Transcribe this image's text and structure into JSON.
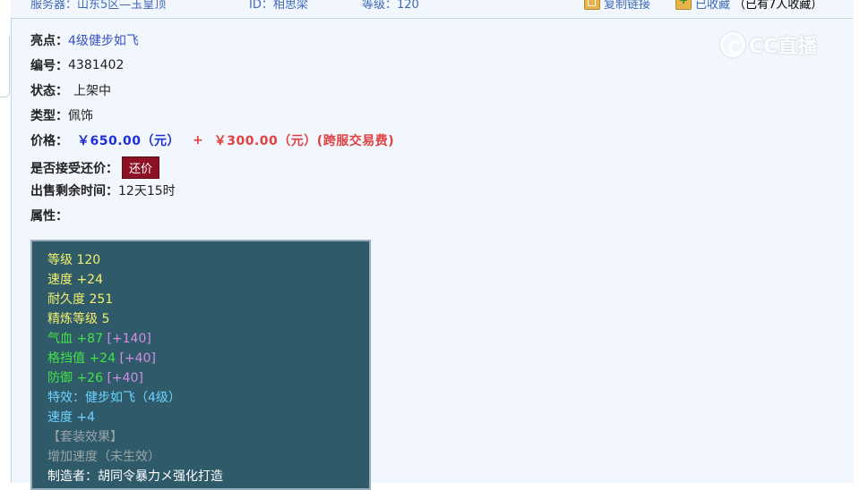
{
  "topbar": {
    "server_label": "服务器：",
    "server_value": "山东5区—玉皇顶",
    "id_label": "ID：",
    "id_value": "相思梁",
    "level_label": "等级：",
    "level_value": "120",
    "copy_link": "复制链接",
    "favorited": "已收藏",
    "fav_count": "（已有7人收藏）"
  },
  "info": {
    "highlight_label": "亮点：",
    "highlight_value": "4级健步如飞",
    "number_label": "编号：",
    "number_value": "4381402",
    "status_label": "状态：",
    "status_value": "上架中",
    "type_label": "类型：",
    "type_value": "佩饰",
    "price_label": "价格：",
    "price_value": "￥650.00（元）",
    "price_plus": "+",
    "price_fee": "￥300.00（元）(跨服交易费)",
    "bargain_label": "是否接受还价：",
    "bargain_button": "还价",
    "remaining_label": "出售剩余时间：",
    "remaining_value": "12天15时",
    "attr_label": "属性："
  },
  "attributes": {
    "level": "等级 120",
    "speed": "速度 +24",
    "durability": "耐久度 251",
    "refine": "精炼等级 5",
    "hp": "气血 +87",
    "hp_bonus": "[+140]",
    "block": "格挡值 +24",
    "block_bonus": "[+40]",
    "defense": "防御 +26",
    "defense_bonus": "[+40]",
    "effect": "特效：健步如飞（4级）",
    "speed_extra": "速度 +4",
    "set_title": "【套装效果】",
    "set_effect": "增加速度（未生效）",
    "maker": "制造者：胡同令暴力メ强化打造"
  },
  "watermark": {
    "text": "CC直播"
  },
  "colors": {
    "panel_bg": "#f2f6fd",
    "attr_bg": "#2f5a6a",
    "bargain_btn": "#8c1124",
    "price_blue": "#1d2fd8",
    "price_red": "#e04040"
  }
}
